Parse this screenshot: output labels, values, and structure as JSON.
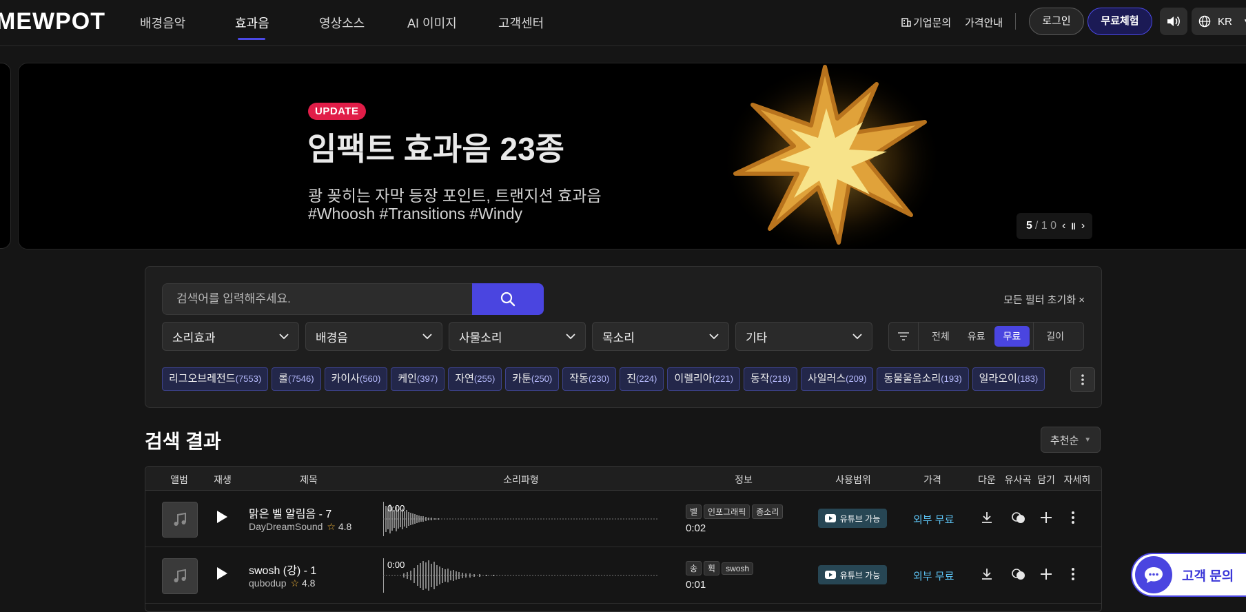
{
  "brand": {
    "logo": "MEWPOT"
  },
  "nav": {
    "items": [
      {
        "label": "배경음악"
      },
      {
        "label": "효과음"
      },
      {
        "label": "영상소스"
      },
      {
        "label": "AI 이미지"
      },
      {
        "label": "고객센터"
      }
    ],
    "active_index": 1,
    "enterprise": "기업문의",
    "pricing": "가격안내",
    "login": "로그인",
    "free_trial": "무료체험",
    "language": "KR"
  },
  "banner": {
    "badge": "UPDATE",
    "title": "임팩트 효과음 23종",
    "subtitle": "쾅 꽂히는 자막 등장 포인트, 트랜지션 효과음",
    "hashtags": "#Whoosh #Transitions #Windy",
    "current": "5",
    "total": "/ 1 0"
  },
  "search": {
    "placeholder": "검색어를 입력해주세요.",
    "reset_filters": "모든 필터 초기화 ×",
    "dropdowns": [
      "소리효과",
      "배경음",
      "사물소리",
      "목소리",
      "기타"
    ],
    "price_filter": [
      "전체",
      "유료",
      "무료"
    ],
    "price_filter_active": "무료",
    "length_label": "길이",
    "chips": [
      {
        "label": "리그오브레전드",
        "count": "(7553)"
      },
      {
        "label": "롤",
        "count": "(7546)"
      },
      {
        "label": "카이사",
        "count": "(560)"
      },
      {
        "label": "케인",
        "count": "(397)"
      },
      {
        "label": "자연",
        "count": "(255)"
      },
      {
        "label": "카툰",
        "count": "(250)"
      },
      {
        "label": "작동",
        "count": "(230)"
      },
      {
        "label": "진",
        "count": "(224)"
      },
      {
        "label": "이렐리아",
        "count": "(221)"
      },
      {
        "label": "동작",
        "count": "(218)"
      },
      {
        "label": "사일러스",
        "count": "(209)"
      },
      {
        "label": "동물울음소리",
        "count": "(193)"
      },
      {
        "label": "일라오이",
        "count": "(183)"
      }
    ]
  },
  "results": {
    "title": "검색 결과",
    "sort": "추천순",
    "columns": [
      "앨범",
      "재생",
      "제목",
      "소리파형",
      "정보",
      "사용범위",
      "가격",
      "다운",
      "유사곡",
      "담기",
      "자세히"
    ],
    "rows": [
      {
        "title": "맑은 벨 알림음 - 7",
        "author": "DayDreamSound",
        "rating": "4.8",
        "time": "0:00",
        "tags": [
          "벨",
          "인포그래픽",
          "종소리"
        ],
        "duration": "0:02",
        "usage": "유튜브 가능",
        "price": "외부 무료"
      },
      {
        "title": "swosh (강) - 1",
        "author": "qubodup",
        "rating": "4.8",
        "time": "0:00",
        "tags": [
          "송",
          "휙",
          "swosh"
        ],
        "duration": "0:01",
        "usage": "유튜브 가능",
        "price": "외부 무료"
      }
    ]
  },
  "chat": {
    "label": "고객 문의"
  },
  "colors": {
    "accent": "#4a45e0",
    "price": "#5cc2f2",
    "update_badge": "#e11d48",
    "youtube_badge": "#274654"
  }
}
